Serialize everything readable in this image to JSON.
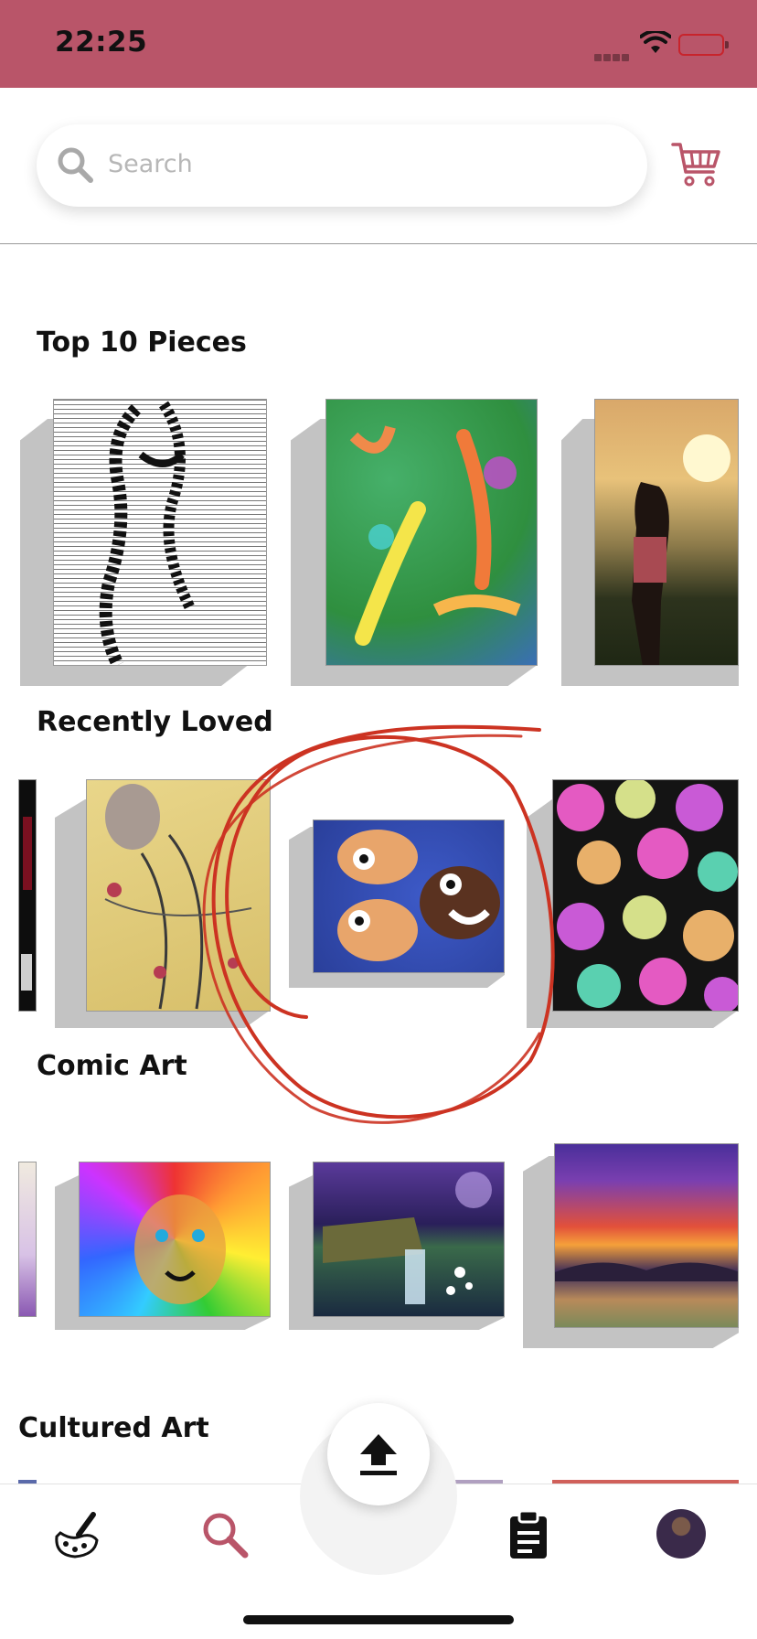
{
  "status_bar": {
    "time": "22:25",
    "background_color": "#b95569",
    "signal_icon": "cellular-signal-icon",
    "wifi_icon": "wifi-icon",
    "battery_icon": "battery-low-icon"
  },
  "header": {
    "search": {
      "placeholder": "Search",
      "icon": "search-icon"
    },
    "cart_icon": "shopping-cart-icon",
    "accent_color": "#b95569"
  },
  "sections": [
    {
      "title": "Top 10 Pieces",
      "items": [
        {
          "name": "text-portrait-artwork"
        },
        {
          "name": "green-abstract-artwork"
        },
        {
          "name": "sunset-field-photo"
        }
      ]
    },
    {
      "title": "Recently Loved",
      "items": [
        {
          "name": "dark-partial-artwork"
        },
        {
          "name": "face-branches-artwork"
        },
        {
          "name": "cartoon-characters-artwork"
        },
        {
          "name": "colorful-hearts-artwork"
        }
      ]
    },
    {
      "title": "Comic Art",
      "items": [
        {
          "name": "purple-partial-artwork"
        },
        {
          "name": "rainbow-lion-artwork"
        },
        {
          "name": "waterfall-painting"
        },
        {
          "name": "sunset-sky-painting"
        }
      ]
    },
    {
      "title": "Cultured Art",
      "items": []
    }
  ],
  "annotation": {
    "description_icon": "red-hand-drawn-circle",
    "color": "#cc3322"
  },
  "bottom_nav": {
    "items": [
      {
        "icon": "art-palette-icon",
        "active": false
      },
      {
        "icon": "search-icon",
        "active": true
      },
      {
        "icon": "upload-icon",
        "active": false
      },
      {
        "icon": "clipboard-icon",
        "active": false
      },
      {
        "icon": "profile-avatar-icon",
        "active": false
      }
    ],
    "active_color": "#b95569"
  }
}
